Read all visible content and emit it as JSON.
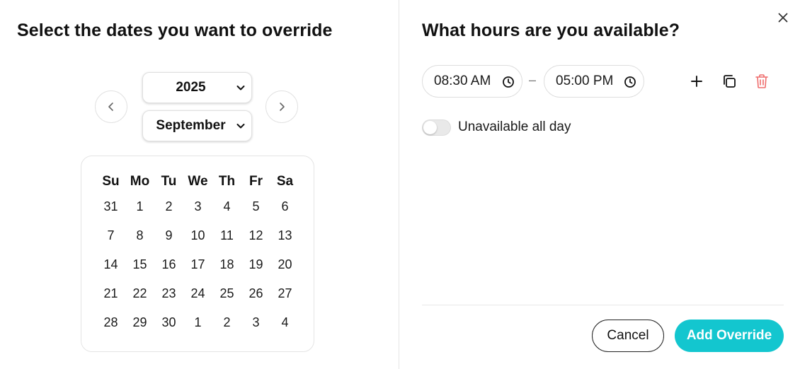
{
  "left": {
    "title": "Select the dates you want to override",
    "year_select": {
      "value": "2025"
    },
    "month_select": {
      "value": "September"
    },
    "weekdays": [
      "Su",
      "Mo",
      "Tu",
      "We",
      "Th",
      "Fr",
      "Sa"
    ],
    "weeks": [
      [
        "31",
        "1",
        "2",
        "3",
        "4",
        "5",
        "6"
      ],
      [
        "7",
        "8",
        "9",
        "10",
        "11",
        "12",
        "13"
      ],
      [
        "14",
        "15",
        "16",
        "17",
        "18",
        "19",
        "20"
      ],
      [
        "21",
        "22",
        "23",
        "24",
        "25",
        "26",
        "27"
      ],
      [
        "28",
        "29",
        "30",
        "1",
        "2",
        "3",
        "4"
      ]
    ]
  },
  "right": {
    "title": "What hours are you available?",
    "time_start": "08:30 AM",
    "time_separator": "–",
    "time_end": "05:00 PM",
    "unavailable_label": "Unavailable all day",
    "unavailable_on": false,
    "cancel_label": "Cancel",
    "add_override_label": "Add Override"
  },
  "icons": {
    "prev": "chevron-left-icon",
    "next": "chevron-right-icon",
    "dropdown": "chevron-down-icon",
    "clock": "clock-icon",
    "add": "plus-icon",
    "copy": "copy-icon",
    "delete": "trash-icon",
    "close": "close-icon"
  },
  "colors": {
    "accent": "#13c6cf",
    "delete": "#ef6b6b",
    "text": "#111111"
  }
}
